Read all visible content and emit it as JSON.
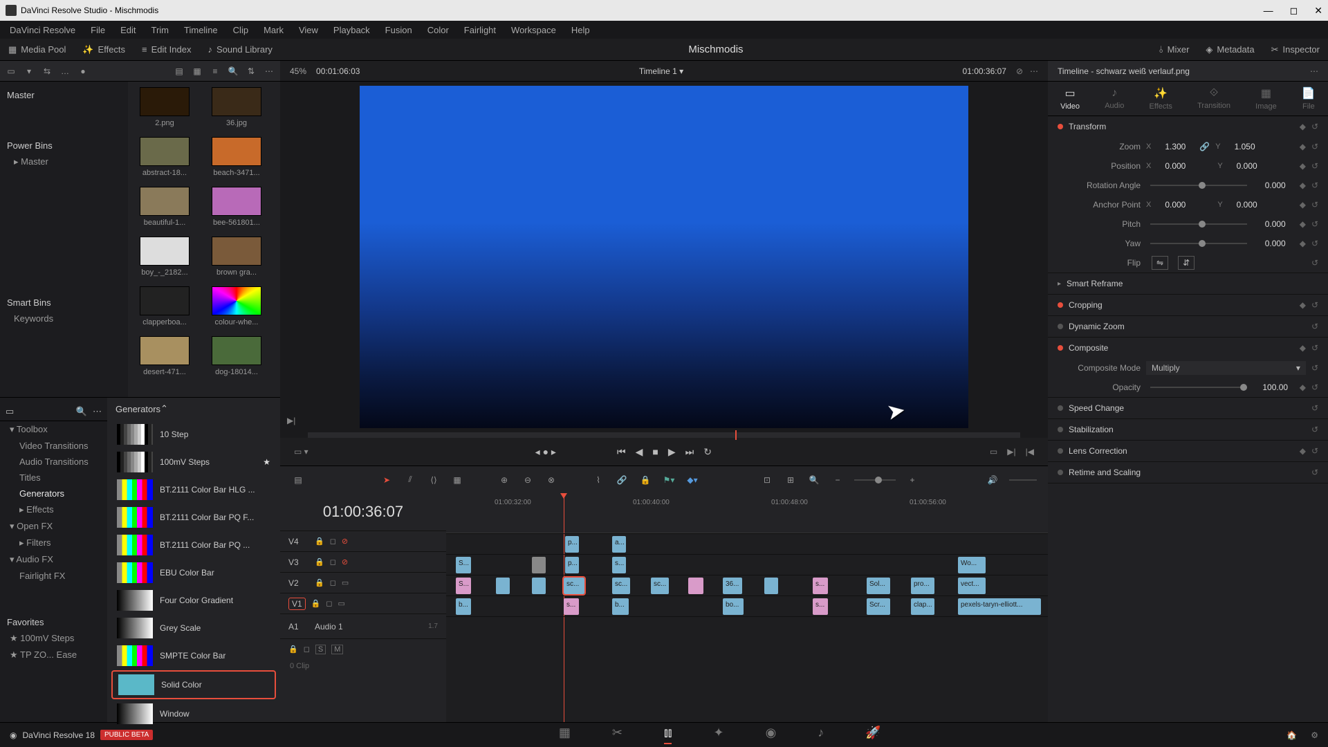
{
  "title": "DaVinci Resolve Studio - Mischmodis",
  "menubar": [
    "DaVinci Resolve",
    "File",
    "Edit",
    "Trim",
    "Timeline",
    "Clip",
    "Mark",
    "View",
    "Playback",
    "Fusion",
    "Color",
    "Fairlight",
    "Workspace",
    "Help"
  ],
  "toolbar": {
    "media_pool": "Media Pool",
    "effects": "Effects",
    "edit_index": "Edit Index",
    "sound_library": "Sound Library",
    "project": "Mischmodis",
    "mixer": "Mixer",
    "metadata": "Metadata",
    "inspector": "Inspector"
  },
  "viewer": {
    "zoom": "45%",
    "tc_left": "00:01:06:03",
    "timeline_name": "Timeline 1",
    "tc_right": "01:00:36:07"
  },
  "bins": {
    "master": "Master",
    "power_bins": "Power Bins",
    "pb_master": "Master",
    "smart_bins": "Smart Bins",
    "keywords": "Keywords"
  },
  "clips": [
    {
      "name": "2.png",
      "bg": "#2a1a08"
    },
    {
      "name": "36.jpg",
      "bg": "#3a2a18"
    },
    {
      "name": "abstract-18...",
      "bg": "#6a6a4a"
    },
    {
      "name": "beach-3471...",
      "bg": "#c86a2a"
    },
    {
      "name": "beautiful-1...",
      "bg": "#8a7a5a"
    },
    {
      "name": "bee-561801...",
      "bg": "#b86ab8"
    },
    {
      "name": "boy_-_2182...",
      "bg": "#ddd"
    },
    {
      "name": "brown gra...",
      "bg": "#7a5a3a"
    },
    {
      "name": "clapperboa...",
      "bg": "#222"
    },
    {
      "name": "colour-whe...",
      "bg": "conic"
    },
    {
      "name": "desert-471...",
      "bg": "#a89060"
    },
    {
      "name": "dog-18014...",
      "bg": "#4a6a3a"
    }
  ],
  "fx_tree": {
    "toolbox": "Toolbox",
    "video_trans": "Video Transitions",
    "audio_trans": "Audio Transitions",
    "titles": "Titles",
    "generators": "Generators",
    "effects": "Effects",
    "open_fx": "Open FX",
    "filters": "Filters",
    "audio_fx": "Audio FX",
    "fairlight_fx": "Fairlight FX",
    "favorites": "Favorites",
    "fav1": "100mV Steps",
    "fav2": "TP ZO... Ease"
  },
  "generators_hdr": "Generators",
  "generators": [
    {
      "name": "10 Step",
      "cls": "step"
    },
    {
      "name": "100mV Steps",
      "cls": "step",
      "star": true
    },
    {
      "name": "BT.2111 Color Bar HLG ...",
      "cls": "bars"
    },
    {
      "name": "BT.2111 Color Bar PQ F...",
      "cls": "bars"
    },
    {
      "name": "BT.2111 Color Bar PQ ...",
      "cls": "bars"
    },
    {
      "name": "EBU Color Bar",
      "cls": "bars"
    },
    {
      "name": "Four Color Gradient",
      "cls": "gray"
    },
    {
      "name": "Grey Scale",
      "cls": "gray"
    },
    {
      "name": "SMPTE Color Bar",
      "cls": "bars"
    },
    {
      "name": "Solid Color",
      "cls": "solid",
      "selected": true
    },
    {
      "name": "Window",
      "cls": "gray"
    }
  ],
  "timeline": {
    "tc": "01:00:36:07",
    "ticks": [
      "01:00:32:00",
      "01:00:40:00",
      "01:00:48:00",
      "01:00:56:00"
    ],
    "tracks": [
      "V4",
      "V3",
      "V2",
      "V1"
    ],
    "audio": {
      "a1": "A1",
      "name": "Audio 1",
      "meta": "1.7",
      "clip": "0 Clip"
    }
  },
  "inspector": {
    "clip": "Timeline - schwarz weiß verlauf.png",
    "tabs": {
      "video": "Video",
      "audio": "Audio",
      "effects": "Effects",
      "transition": "Transition",
      "image": "Image",
      "file": "File"
    },
    "transform": {
      "label": "Transform",
      "zoom": "Zoom",
      "zoom_x": "1.300",
      "zoom_y": "1.050",
      "position": "Position",
      "pos_x": "0.000",
      "pos_y": "0.000",
      "rotation": "Rotation Angle",
      "rot_v": "0.000",
      "anchor": "Anchor Point",
      "anc_x": "0.000",
      "anc_y": "0.000",
      "pitch": "Pitch",
      "pitch_v": "0.000",
      "yaw": "Yaw",
      "yaw_v": "0.000",
      "flip": "Flip"
    },
    "smart_reframe": "Smart Reframe",
    "cropping": "Cropping",
    "dynamic_zoom": "Dynamic Zoom",
    "composite": {
      "label": "Composite",
      "mode_lbl": "Composite Mode",
      "mode": "Multiply",
      "opacity_lbl": "Opacity",
      "opacity": "100.00"
    },
    "speed": "Speed Change",
    "stabilization": "Stabilization",
    "lens": "Lens Correction",
    "retime": "Retime and Scaling"
  },
  "bottom": {
    "ver": "DaVinci Resolve 18",
    "beta": "PUBLIC BETA"
  }
}
